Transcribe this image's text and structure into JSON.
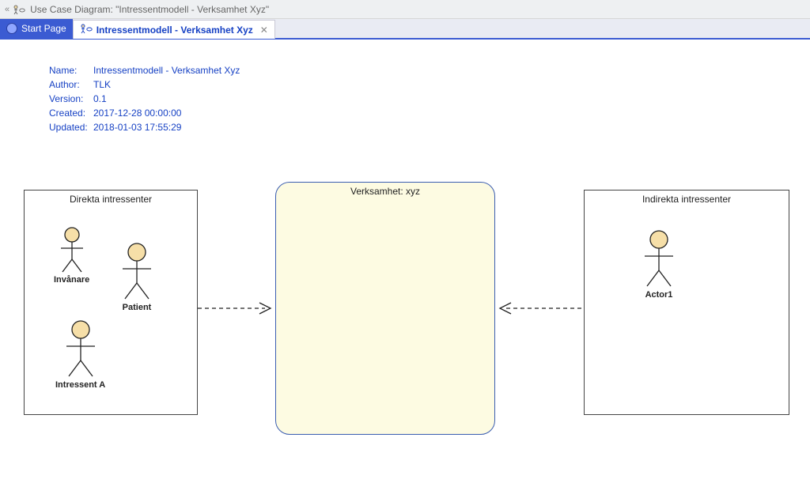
{
  "titlebar": {
    "text": "Use Case Diagram: \"Intressentmodell - Verksamhet Xyz\""
  },
  "tabs": {
    "start": "Start Page",
    "active": "Intressentmodell - Verksamhet Xyz"
  },
  "meta": {
    "name_label": "Name:",
    "name_value": "Intressentmodell - Verksamhet Xyz",
    "author_label": "Author:",
    "author_value": "TLK",
    "version_label": "Version:",
    "version_value": "0.1",
    "created_label": "Created:",
    "created_value": "2017-12-28 00:00:00",
    "updated_label": "Updated:",
    "updated_value": "2018-01-03 17:55:29"
  },
  "boxes": {
    "direkta_title": "Direkta intressenter",
    "central_title": "Verksamhet: xyz",
    "indirekta_title": "Indirekta intressenter"
  },
  "actors": {
    "invanare": "Invånare",
    "patient": "Patient",
    "intressent_a": "Intressent A",
    "actor1": "Actor1"
  },
  "colors": {
    "accent": "#1641c4",
    "actor_fill": "#f6dfa8",
    "central_bg": "#fdfbe2"
  }
}
